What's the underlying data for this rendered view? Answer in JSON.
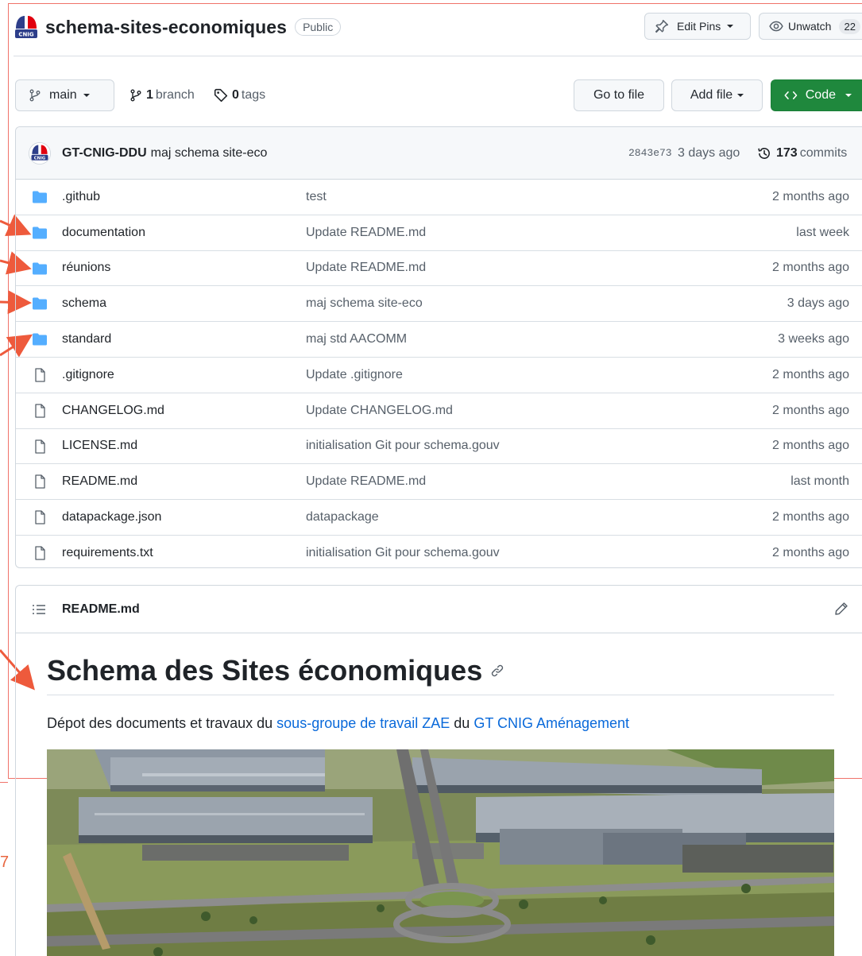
{
  "repo": {
    "name": "schema-sites-economiques",
    "visibility": "Public",
    "edit_pins_label": "Edit Pins",
    "unwatch_label": "Unwatch",
    "watch_count": "22"
  },
  "branchbar": {
    "branch_label": "main",
    "branch_count": "1",
    "branch_word": "branch",
    "tag_count": "0",
    "tag_word": "tags",
    "goto_file_label": "Go to file",
    "add_file_label": "Add file",
    "code_label": "Code"
  },
  "commit": {
    "author": "GT-CNIG-DDU",
    "message": "maj schema site-eco",
    "sha": "2843e73",
    "time": "3 days ago",
    "count": "173",
    "count_word": "commits"
  },
  "files": [
    {
      "name": ".github",
      "type": "folder",
      "message": "test",
      "time": "2 months ago"
    },
    {
      "name": "documentation",
      "type": "folder",
      "message": "Update README.md",
      "time": "last week"
    },
    {
      "name": "réunions",
      "type": "folder",
      "message": "Update README.md",
      "time": "2 months ago"
    },
    {
      "name": "schema",
      "type": "folder",
      "message": "maj schema site-eco",
      "time": "3 days ago"
    },
    {
      "name": "standard",
      "type": "folder",
      "message": "maj std AACOMM",
      "time": "3 weeks ago"
    },
    {
      "name": ".gitignore",
      "type": "file",
      "message": "Update .gitignore",
      "time": "2 months ago"
    },
    {
      "name": "CHANGELOG.md",
      "type": "file",
      "message": "Update CHANGELOG.md",
      "time": "2 months ago"
    },
    {
      "name": "LICENSE.md",
      "type": "file",
      "message": "initialisation Git pour schema.gouv",
      "time": "2 months ago"
    },
    {
      "name": "README.md",
      "type": "file",
      "message": "Update README.md",
      "time": "last month"
    },
    {
      "name": "datapackage.json",
      "type": "file",
      "message": "datapackage",
      "time": "2 months ago"
    },
    {
      "name": "requirements.txt",
      "type": "file",
      "message": "initialisation Git pour schema.gouv",
      "time": "2 months ago"
    }
  ],
  "readme": {
    "filename": "README.md",
    "title": "Schema des Sites économiques",
    "desc_prefix": "Dépot des documents et travaux du ",
    "link1": "sous-groupe de travail ZAE",
    "desc_mid": " du ",
    "link2": "GT CNIG Aménagement"
  },
  "annotation": {
    "side_number": "7"
  },
  "colors": {
    "folder": "#54aeff",
    "accent_green": "#1f883d",
    "link": "#0969da",
    "annotation_red": "#f0736a"
  }
}
